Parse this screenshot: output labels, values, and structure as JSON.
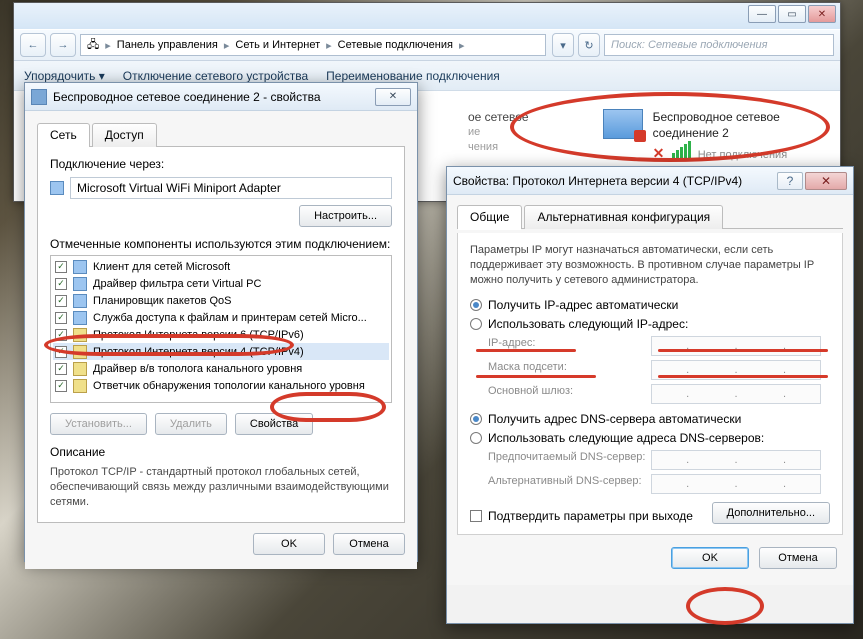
{
  "explorer": {
    "nav": {
      "back_glyph": "←",
      "fwd_glyph": "→"
    },
    "breadcrumb": {
      "root_glyph": "🖧",
      "seg1": "Панель управления",
      "seg2": "Сеть и Интернет",
      "seg3": "Сетевые подключения",
      "sep": "▸"
    },
    "search_placeholder": "Поиск: Сетевые подключения",
    "toolbar": {
      "organize": "Упорядочить ▾",
      "disable": "Отключение сетевого устройства",
      "rename": "Переименование подключения"
    },
    "conn_left": {
      "title": "ое сетевое",
      "sub1": "ие",
      "sub2": "чения"
    },
    "conn_right": {
      "title": "Беспроводное сетевое",
      "title2": "соединение 2",
      "status": "Нет подключения",
      "x": "✕"
    },
    "winbtn": {
      "min": "—",
      "max": "▭",
      "close": "✕"
    }
  },
  "props": {
    "title": "Беспроводное сетевое соединение 2 - свойства",
    "close_glyph": "✕",
    "tab_network": "Сеть",
    "tab_access": "Доступ",
    "connect_via_label": "Подключение через:",
    "adapter": "Microsoft Virtual WiFi Miniport Adapter",
    "configure_btn": "Настроить...",
    "components_label": "Отмеченные компоненты используются этим подключением:",
    "components": [
      "Клиент для сетей Microsoft",
      "Драйвер фильтра сети Virtual PC",
      "Планировщик пакетов QoS",
      "Служба доступа к файлам и принтерам сетей Micro...",
      "Протокол Интернета версии 6 (TCP/IPv6)",
      "Протокол Интернета версии 4 (TCP/IPv4)",
      "Драйвер в/в тополога канального уровня",
      "Ответчик обнаружения топологии канального уровня"
    ],
    "install_btn": "Установить...",
    "uninstall_btn": "Удалить",
    "properties_btn": "Свойства",
    "desc_label": "Описание",
    "desc_text": "Протокол TCP/IP - стандартный протокол глобальных сетей, обеспечивающий связь между различными взаимодействующими сетями.",
    "ok_btn": "OK",
    "cancel_btn": "Отмена"
  },
  "ipv4": {
    "title": "Свойства: Протокол Интернета версии 4 (TCP/IPv4)",
    "help_glyph": "?",
    "close_glyph": "✕",
    "tab_general": "Общие",
    "tab_alt": "Альтернативная конфигурация",
    "note": "Параметры IP могут назначаться автоматически, если сеть поддерживает эту возможность. В противном случае параметры IP можно получить у сетевого администратора.",
    "radio_auto_ip": "Получить IP-адрес автоматически",
    "radio_manual_ip": "Использовать следующий IP-адрес:",
    "lbl_ip": "IP-адрес:",
    "lbl_mask": "Маска подсети:",
    "lbl_gw": "Основной шлюз:",
    "radio_auto_dns": "Получить адрес DNS-сервера автоматически",
    "radio_manual_dns": "Использовать следующие адреса DNS-серверов:",
    "lbl_dns1": "Предпочитаемый DNS-сервер:",
    "lbl_dns2": "Альтернативный DNS-сервер:",
    "chk_validate": "Подтвердить параметры при выходе",
    "advanced_btn": "Дополнительно...",
    "ok_btn": "OK",
    "cancel_btn": "Отмена",
    "ipdot": "."
  }
}
